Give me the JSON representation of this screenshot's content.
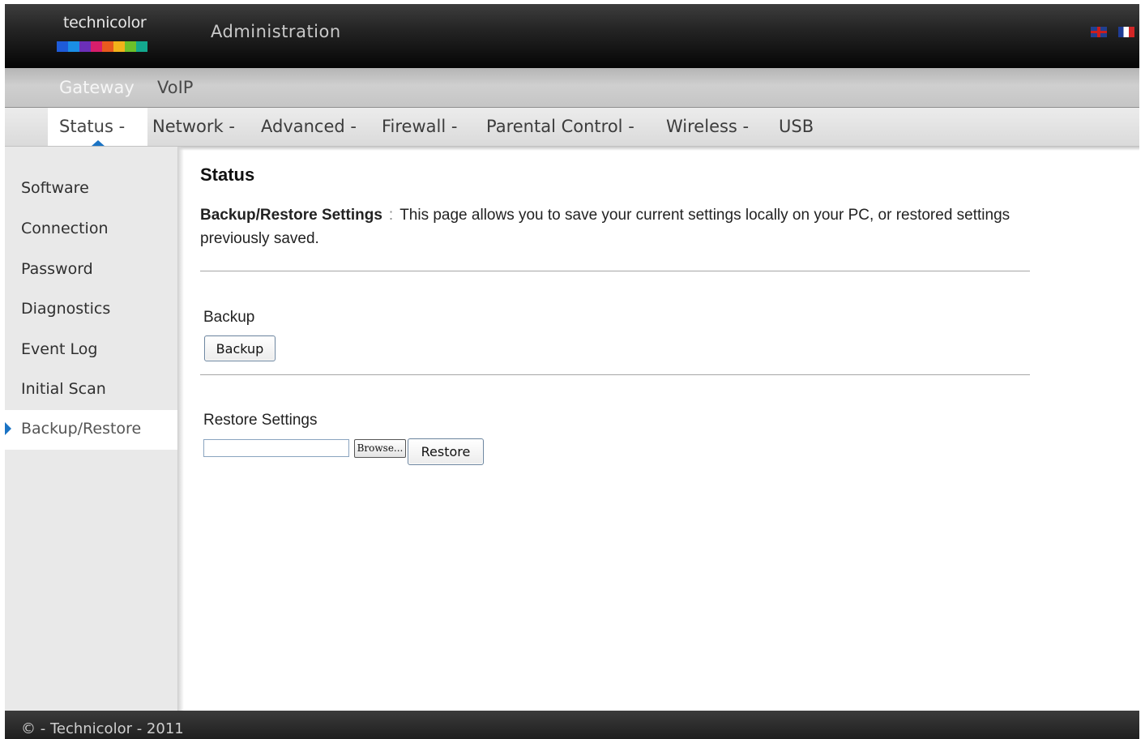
{
  "header": {
    "logo_text": "technicolor",
    "logo_colors": [
      "#1e5bd8",
      "#1a8ee6",
      "#6b2fb8",
      "#d81e6b",
      "#e85a1e",
      "#f2b21a",
      "#6cc02a",
      "#13a88e"
    ],
    "title": "Administration",
    "flags": [
      "uk-flag",
      "fr-flag"
    ]
  },
  "topnav": {
    "items": [
      {
        "label": "Gateway",
        "active": true
      },
      {
        "label": "VoIP",
        "active": false
      }
    ]
  },
  "subnav": {
    "items": [
      {
        "label": "Status -",
        "active": true
      },
      {
        "label": "Network -"
      },
      {
        "label": "Advanced -"
      },
      {
        "label": "Firewall -"
      },
      {
        "label": "Parental Control -"
      },
      {
        "label": "Wireless -"
      },
      {
        "label": "USB"
      }
    ],
    "accent": "#1a73c4"
  },
  "sidebar": {
    "items": [
      {
        "label": "Software"
      },
      {
        "label": "Connection"
      },
      {
        "label": "Password"
      },
      {
        "label": "Diagnostics"
      },
      {
        "label": "Event Log"
      },
      {
        "label": "Initial Scan"
      },
      {
        "label": "Backup/Restore",
        "active": true
      }
    ]
  },
  "main": {
    "title": "Status",
    "desc_label": "Backup/Restore Settings",
    "desc_sep": ":",
    "desc_text": "This page allows you to save your current settings locally on your PC, or restored settings previously saved.",
    "backup": {
      "label": "Backup",
      "button": "Backup"
    },
    "restore": {
      "label": "Restore Settings",
      "file_value": "",
      "browse_button": "Browse...",
      "button": "Restore"
    }
  },
  "footer": {
    "text": "© - Technicolor - 2011"
  }
}
